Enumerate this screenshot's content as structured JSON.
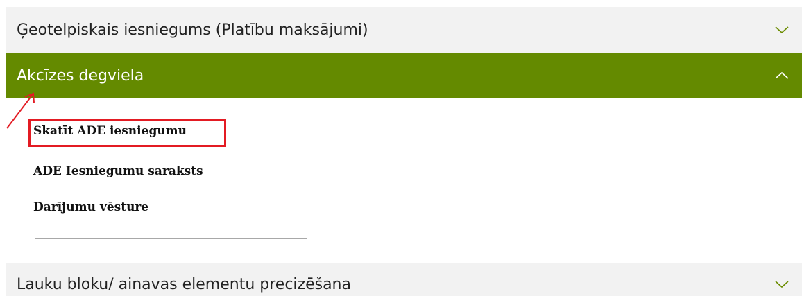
{
  "accordion": {
    "sections": [
      {
        "title": "Ģeotelpiskais iesniegums (Platību maksājumi)",
        "state": "collapsed",
        "chevron": "chevron-down-icon"
      },
      {
        "title": "Akcīzes degviela",
        "state": "expanded",
        "chevron": "chevron-up-icon"
      },
      {
        "title": "Lauku bloku/ ainavas elementu precizēšana",
        "state": "collapsed",
        "chevron": "chevron-down-icon"
      }
    ],
    "expanded_links": [
      "Skatīt ADE iesniegumu",
      "ADE Iesniegumu saraksts",
      "Darījumu vēsture"
    ]
  },
  "annotations": {
    "highlighted_link": "Skatīt ADE iesniegumu",
    "arrow_color": "#e31b23",
    "box_color": "#e31b23"
  },
  "colors": {
    "accent_green": "#648a00",
    "collapsed_bg": "#f2f2f2",
    "chevron_green": "#6b8c00"
  }
}
